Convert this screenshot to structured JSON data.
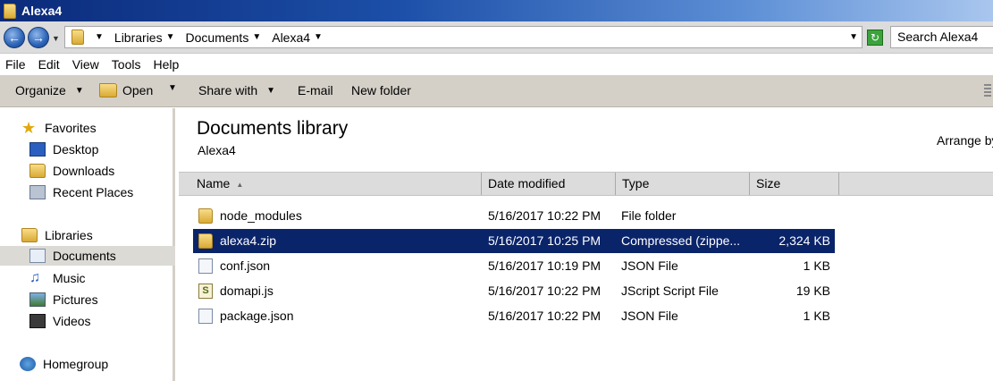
{
  "window": {
    "title": "Alexa4"
  },
  "address": {
    "crumbs": [
      "Libraries",
      "Documents",
      "Alexa4"
    ],
    "search_placeholder": "Search Alexa4"
  },
  "menu": [
    "File",
    "Edit",
    "View",
    "Tools",
    "Help"
  ],
  "toolbar": {
    "organize": "Organize",
    "open": "Open",
    "share_with": "Share with",
    "email": "E-mail",
    "new_folder": "New folder"
  },
  "sidebar": {
    "favorites": {
      "label": "Favorites",
      "items": [
        "Desktop",
        "Downloads",
        "Recent Places"
      ]
    },
    "libraries": {
      "label": "Libraries",
      "items": [
        "Documents",
        "Music",
        "Pictures",
        "Videos"
      ]
    },
    "homegroup": "Homegroup"
  },
  "content": {
    "title": "Documents library",
    "subtitle": "Alexa4",
    "arrange_by": "Arrange by"
  },
  "columns": {
    "name": "Name",
    "date": "Date modified",
    "type": "Type",
    "size": "Size"
  },
  "files": [
    {
      "name": "node_modules",
      "date": "5/16/2017 10:22 PM",
      "type": "File folder",
      "size": "",
      "icon": "folder-icon"
    },
    {
      "name": "alexa4.zip",
      "date": "5/16/2017 10:25 PM",
      "type": "Compressed (zippe...",
      "size": "2,324 KB",
      "icon": "zip-folder-icon"
    },
    {
      "name": "conf.json",
      "date": "5/16/2017 10:19 PM",
      "type": "JSON File",
      "size": "1 KB",
      "icon": "file-icon"
    },
    {
      "name": "domapi.js",
      "date": "5/16/2017 10:22 PM",
      "type": "JScript Script File",
      "size": "19 KB",
      "icon": "script-icon"
    },
    {
      "name": "package.json",
      "date": "5/16/2017 10:22 PM",
      "type": "JSON File",
      "size": "1 KB",
      "icon": "file-icon"
    }
  ],
  "colors": {
    "selection": "#0a246a",
    "titlebar": "#1c4fa8",
    "toolbar": "#d4d0c8"
  }
}
